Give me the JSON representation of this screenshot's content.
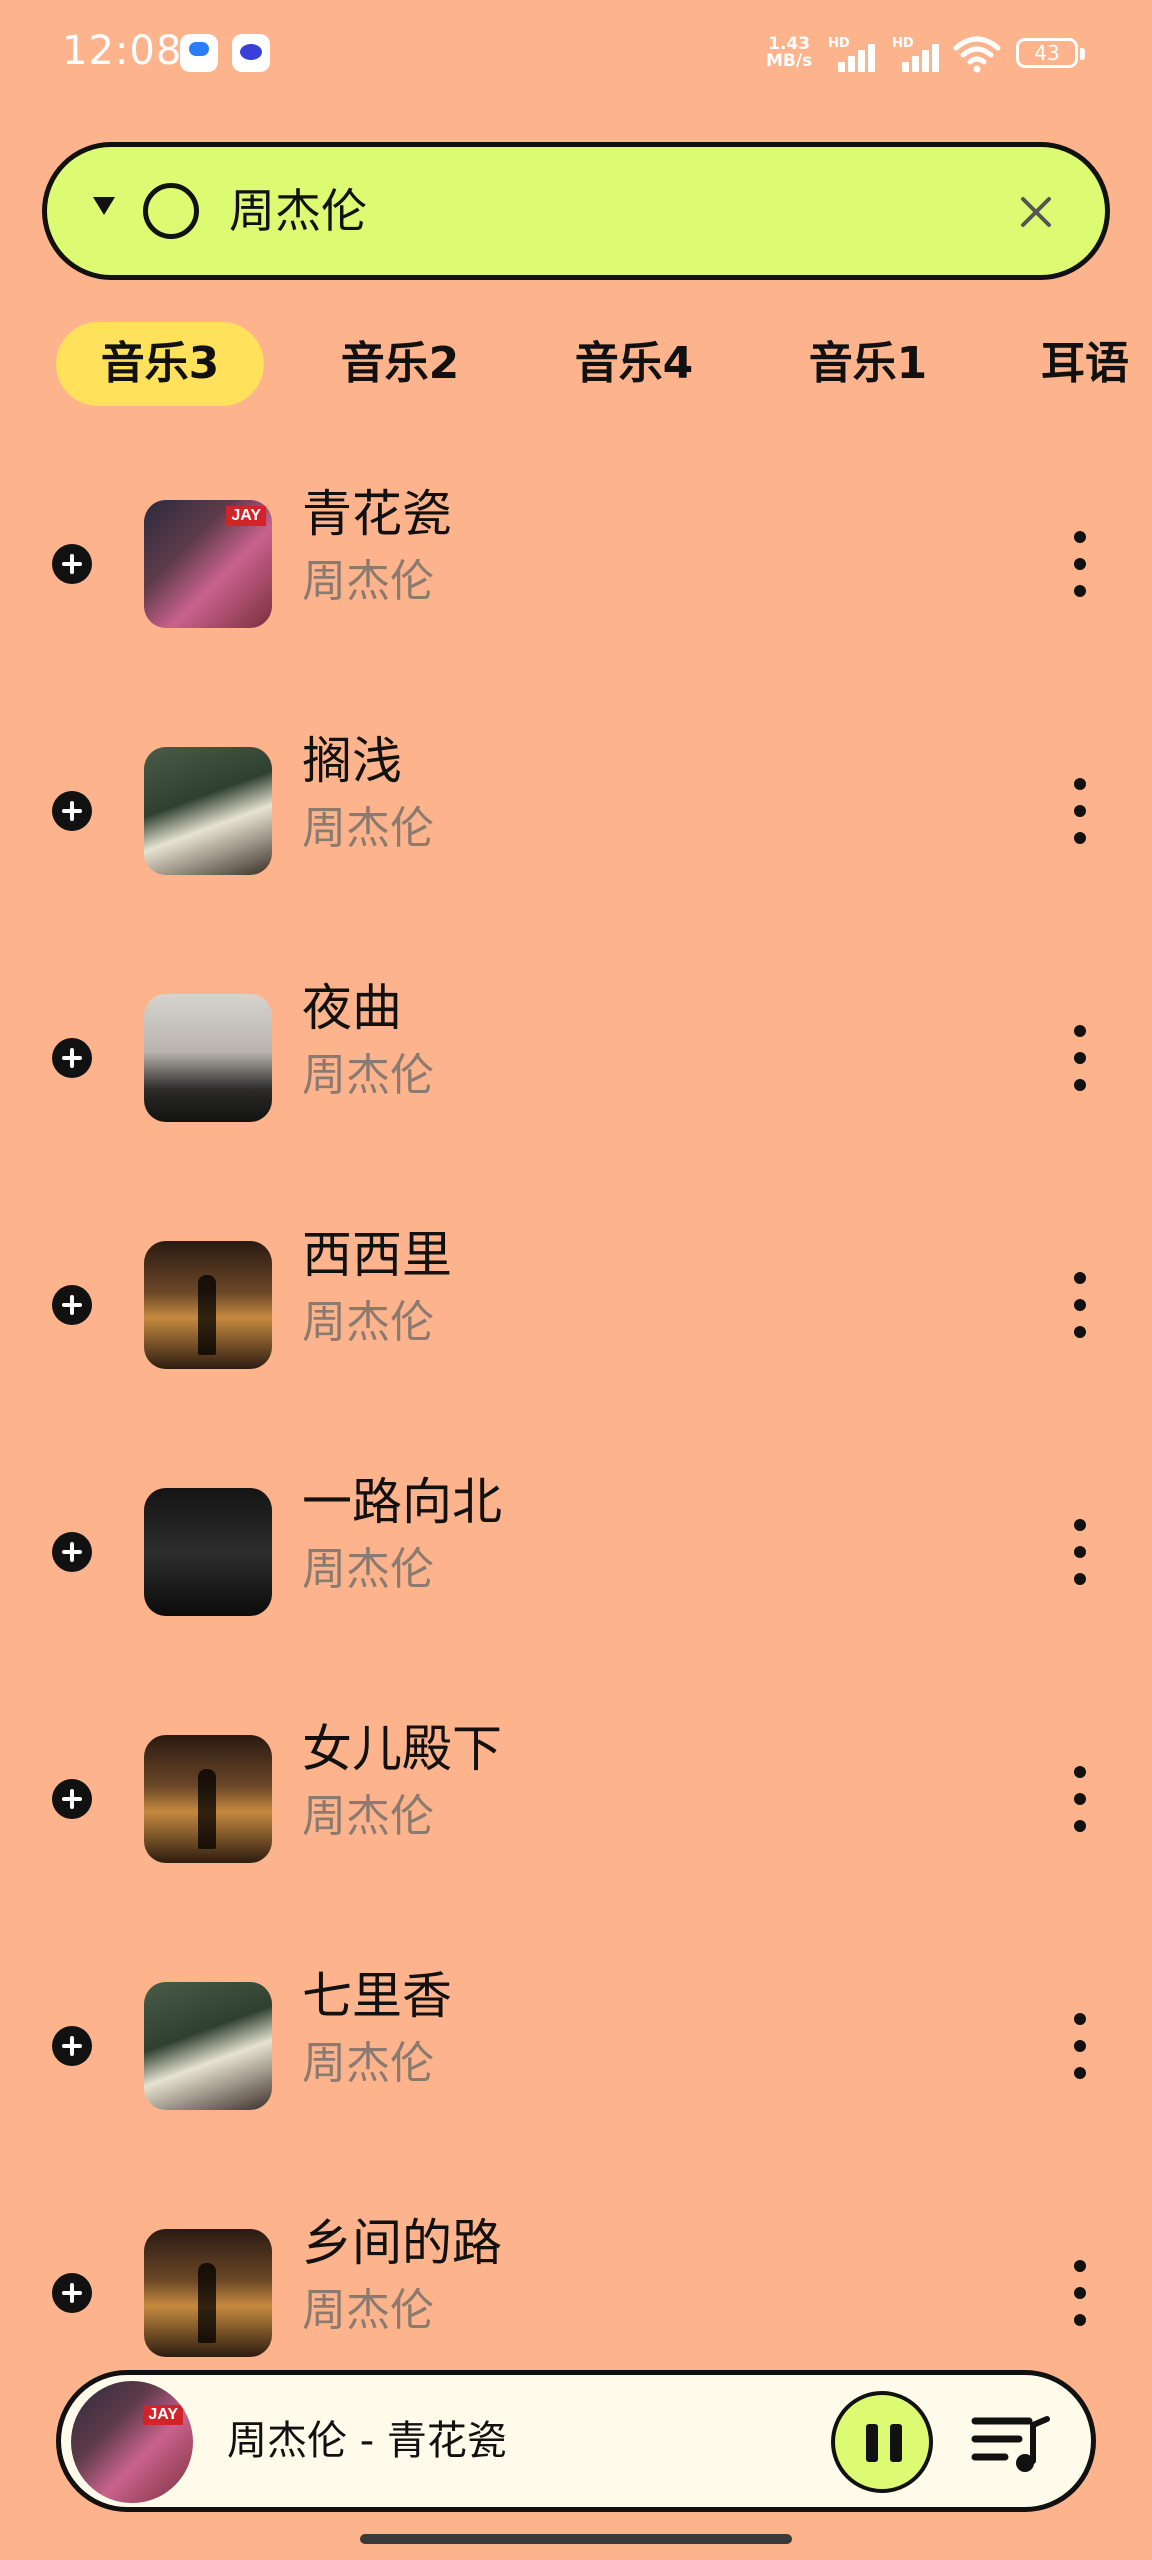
{
  "status_bar": {
    "time": "12:08",
    "net_speed_top": "1.43",
    "net_speed_bottom": "MB/s",
    "sim1_badge": "HD",
    "sim2_badge": "HD",
    "battery": "43"
  },
  "search": {
    "query": "周杰伦"
  },
  "tabs": [
    {
      "label": "音乐3",
      "active": true
    },
    {
      "label": "音乐2",
      "active": false
    },
    {
      "label": "音乐4",
      "active": false
    },
    {
      "label": "音乐1",
      "active": false
    },
    {
      "label": "耳语",
      "active": false
    }
  ],
  "songs": [
    {
      "title": "青花瓷",
      "artist": "周杰伦",
      "cover": "jay-album-cover",
      "cover_label": "JAY"
    },
    {
      "title": "搁浅",
      "artist": "周杰伦",
      "cover": "qilixiang-album-cover"
    },
    {
      "title": "夜曲",
      "artist": "周杰伦",
      "cover": "november-chopin-album-cover"
    },
    {
      "title": "西西里",
      "artist": "周杰伦",
      "cover": "greatest-works-album-cover"
    },
    {
      "title": "一路向北",
      "artist": "周杰伦",
      "cover": "initial-d-album-cover"
    },
    {
      "title": "女儿殿下",
      "artist": "周杰伦",
      "cover": "greatest-works-album-cover"
    },
    {
      "title": "七里香",
      "artist": "周杰伦",
      "cover": "qilixiang-album-cover"
    },
    {
      "title": "乡间的路",
      "artist": "周杰伦",
      "cover": "greatest-works-album-cover"
    }
  ],
  "player": {
    "now_playing": "周杰伦 - 青花瓷",
    "cover_label": "JAY",
    "state": "playing"
  },
  "colors": {
    "background": "#FDB48D",
    "search_bg": "#DDFB72",
    "active_tab": "#FFE15B",
    "player_bg": "#FFFBEB",
    "artist_text": "#8a7a70"
  }
}
